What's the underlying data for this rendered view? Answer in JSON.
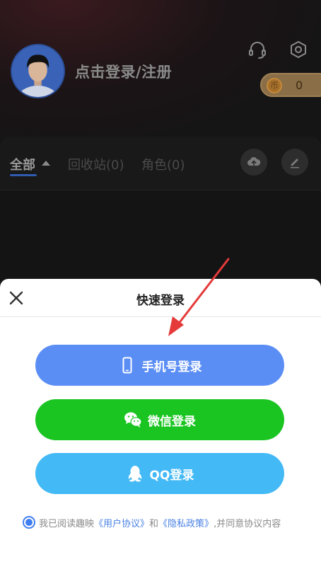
{
  "profile": {
    "login_text": "点击登录/注册",
    "coin_count": "0",
    "coin_symbol": "币"
  },
  "icons": {
    "support": "headset-icon",
    "settings": "hexagon-settings-icon",
    "upload": "cloud-upload-icon",
    "edit": "pencil-icon"
  },
  "tabs": [
    {
      "label": "全部"
    },
    {
      "label": "回收站(0)"
    },
    {
      "label": "角色(0)"
    }
  ],
  "sheet": {
    "title": "快速登录",
    "buttons": {
      "phone": "手机号登录",
      "wechat": "微信登录",
      "qq": "QQ登录"
    },
    "agreement": {
      "prefix": "我已阅读趣映",
      "user_agreement": "《用户协议》",
      "and": "和",
      "privacy_policy": "《隐私政策》",
      "suffix": ",并同意协议内容"
    }
  },
  "colors": {
    "phone_button": "#5b8ef5",
    "wechat_button": "#1ac421",
    "qq_button": "#43b9f5",
    "link": "#4a82e6",
    "arrow": "#e53a3a"
  }
}
